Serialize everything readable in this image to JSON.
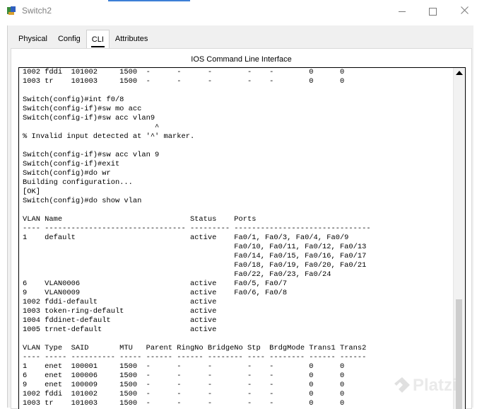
{
  "window": {
    "title": "Switch2",
    "minimize_icon": "minimize-icon",
    "maximize_icon": "maximize-icon",
    "close_icon": "close-icon"
  },
  "tabs": [
    {
      "label": "Physical",
      "active": false
    },
    {
      "label": "Config",
      "active": false
    },
    {
      "label": "CLI",
      "active": true
    },
    {
      "label": "Attributes",
      "active": false
    }
  ],
  "cli": {
    "header": "IOS Command Line Interface",
    "lines": [
      "1002 fddi  101002     1500  -      -      -        -    -        0      0",
      "1003 tr    101003     1500  -      -      -        -    -        0      0",
      "",
      "Switch(config)#int f0/8",
      "Switch(config-if)#sw mo acc",
      "Switch(config-if)#sw acc vlan9",
      "                              ^",
      "% Invalid input detected at '^' marker.",
      "",
      "Switch(config-if)#sw acc vlan 9",
      "Switch(config-if)#exit",
      "Switch(config)#do wr",
      "Building configuration...",
      "[OK]",
      "Switch(config)#do show vlan",
      "",
      "VLAN Name                             Status    Ports",
      "---- -------------------------------- --------- -------------------------------",
      "1    default                          active    Fa0/1, Fa0/3, Fa0/4, Fa0/9",
      "                                                Fa0/10, Fa0/11, Fa0/12, Fa0/13",
      "                                                Fa0/14, Fa0/15, Fa0/16, Fa0/17",
      "                                                Fa0/18, Fa0/19, Fa0/20, Fa0/21",
      "                                                Fa0/22, Fa0/23, Fa0/24",
      "6    VLAN0006                         active    Fa0/5, Fa0/7",
      "9    VLAN0009                         active    Fa0/6, Fa0/8",
      "1002 fddi-default                     active",
      "1003 token-ring-default               active",
      "1004 fddinet-default                  active",
      "1005 trnet-default                    active",
      "",
      "VLAN Type  SAID       MTU   Parent RingNo BridgeNo Stp  BrdgMode Trans1 Trans2",
      "---- ----- ---------- ----- ------ ------ -------- ---- -------- ------ ------",
      "1    enet  100001     1500  -      -      -        -    -        0      0",
      "6    enet  100006     1500  -      -      -        -    -        0      0",
      "9    enet  100009     1500  -      -      -        -    -        0      0",
      "1002 fddi  101002     1500  -      -      -        -    -        0      0",
      "1003 tr    101003     1500  -      -      -        -    -        0      0"
    ]
  },
  "watermark": {
    "text": "Platzi",
    "icon": "platzi-logo-icon"
  }
}
